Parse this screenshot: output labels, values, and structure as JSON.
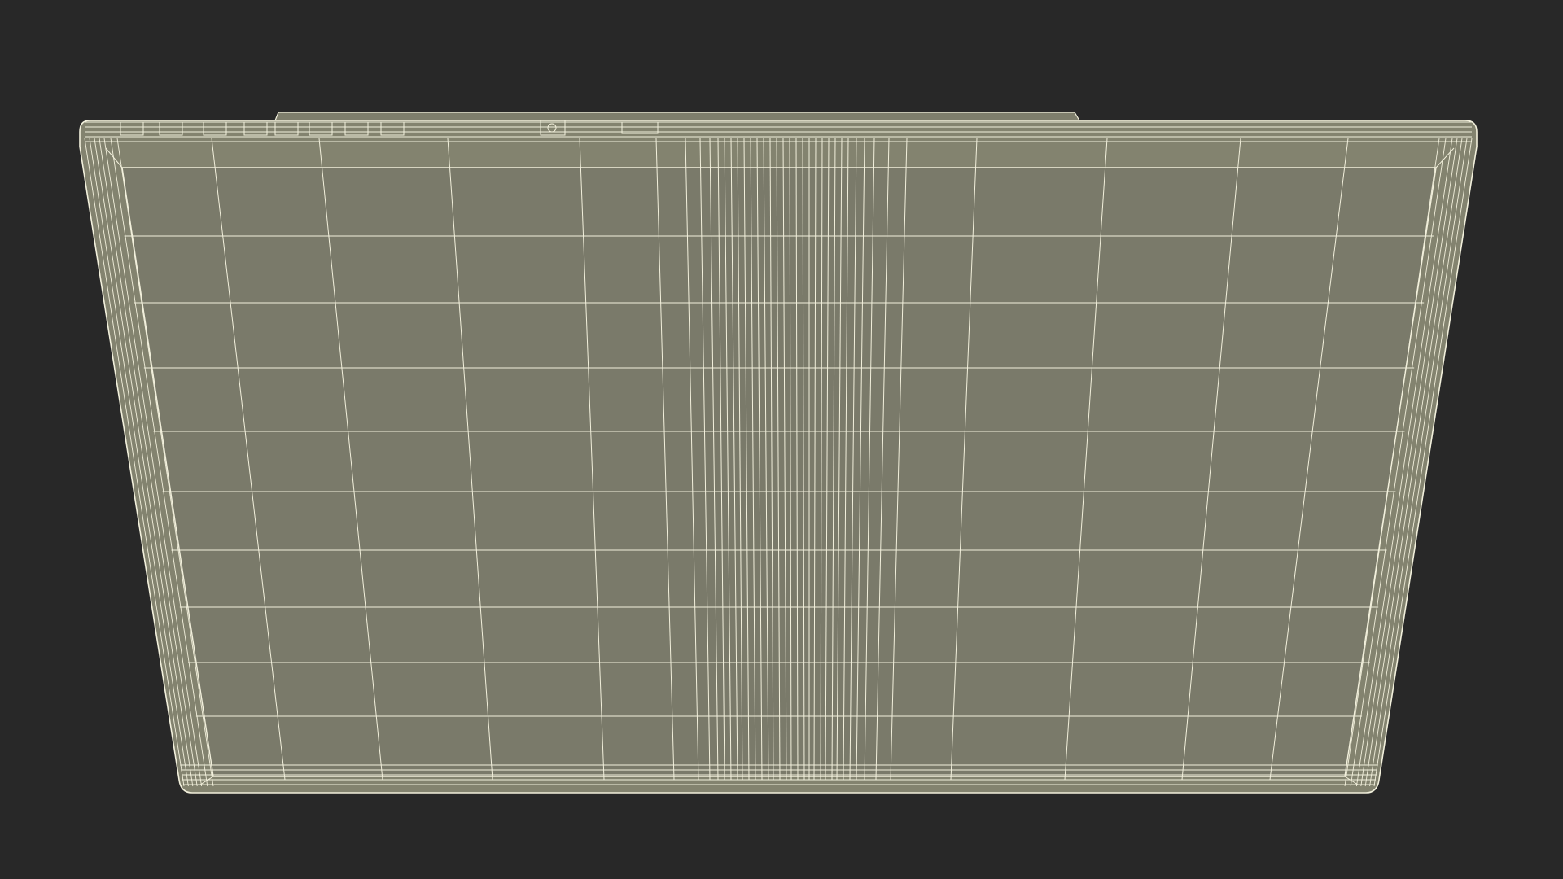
{
  "scene": {
    "background_color": "#282828",
    "model_fill_color": "#7a7a6a",
    "frame_fill_color": "#83836f",
    "wire_color": "#f2f0dc",
    "subject": "laptop-lid-wireframe"
  }
}
